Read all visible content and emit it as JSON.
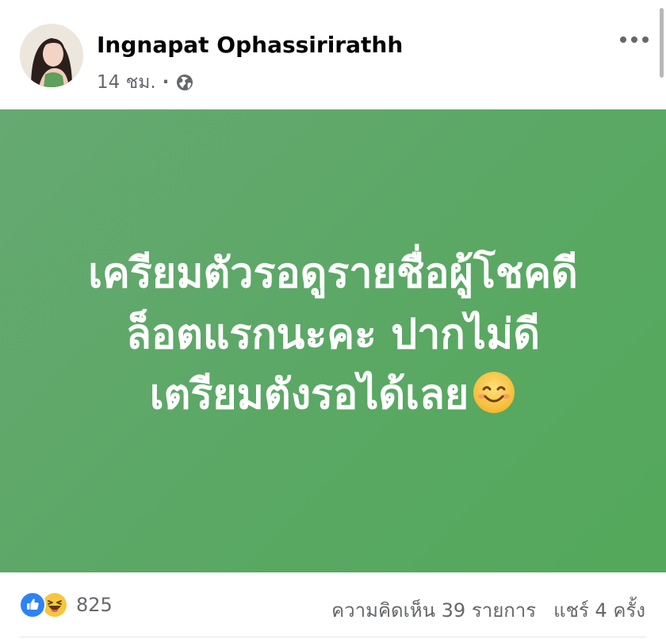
{
  "post": {
    "author": "Ingnapat Ophassirirathh",
    "time": "14 ชม.",
    "privacy_icon": "globe-icon",
    "menu_icon": "more-options-icon",
    "background_color": "#5aa864",
    "text_lines": [
      "เครียมตัวรอดูรายชื่อผู้โชคดี",
      "ล็อตแรกนะคะ ปากไม่ดี",
      "เตรียมตังรอได้เลย"
    ],
    "text_emoji": "smiling-face-icon"
  },
  "footer": {
    "reactions": [
      "like-icon",
      "haha-icon"
    ],
    "reaction_count": "825",
    "comments": "ความคิดเห็น 39 รายการ",
    "shares": "แชร์ 4 ครั้ง"
  }
}
